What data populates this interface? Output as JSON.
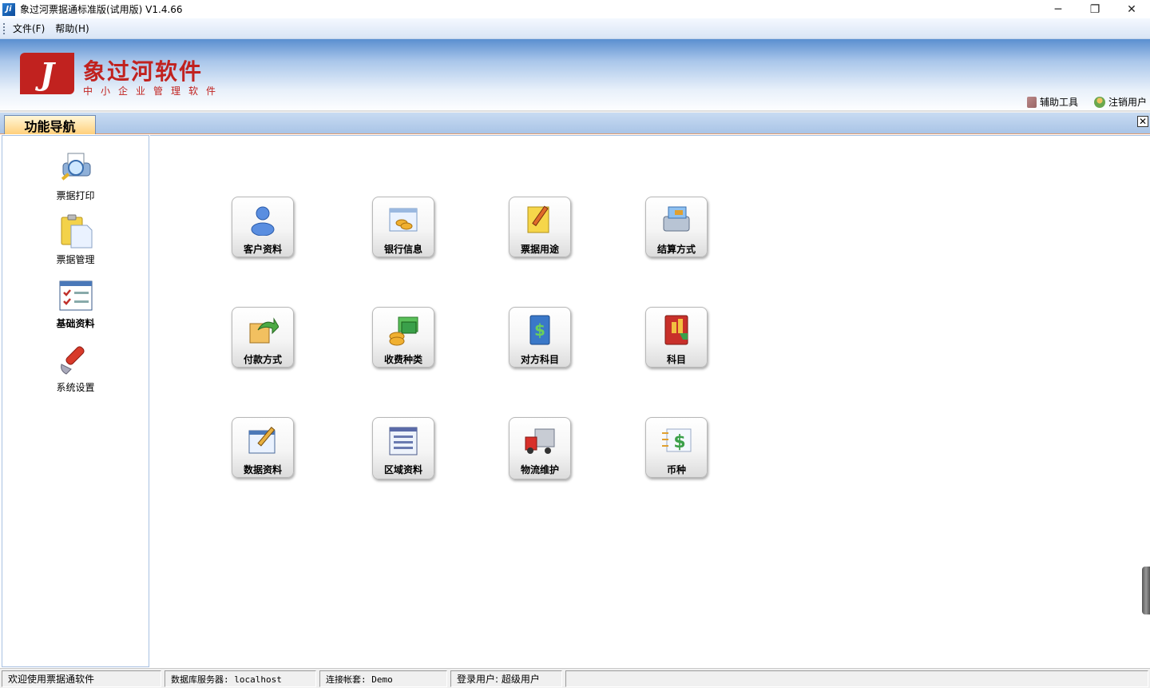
{
  "window": {
    "title": "象过河票据通标准版(试用版) V1.4.66",
    "app_icon_text": "Ji",
    "controls": {
      "minimize": "─",
      "restore": "❐",
      "close": "✕"
    }
  },
  "menu": {
    "items": [
      {
        "label": "文件(F)"
      },
      {
        "label": "帮助(H)"
      }
    ]
  },
  "banner": {
    "logo_mark": "J",
    "title": "象过河软件",
    "subtitle": "中小企业管理软件",
    "tools": [
      {
        "label": "辅助工具",
        "icon": "tools-icon"
      },
      {
        "label": "注销用户",
        "icon": "user-logout-icon"
      }
    ]
  },
  "tab": {
    "label": "功能导航",
    "close": "✕"
  },
  "sidebar": {
    "items": [
      {
        "label": "票据打印",
        "icon": "print-icon",
        "bold": false
      },
      {
        "label": "票据管理",
        "icon": "clipboard-icon",
        "bold": false
      },
      {
        "label": "基础资料",
        "icon": "checklist-icon",
        "bold": true
      },
      {
        "label": "系统设置",
        "icon": "wrench-icon",
        "bold": false
      }
    ]
  },
  "tiles": [
    {
      "label": "客户资料",
      "icon": "customer-icon"
    },
    {
      "label": "银行信息",
      "icon": "bank-icon"
    },
    {
      "label": "票据用途",
      "icon": "note-edit-icon"
    },
    {
      "label": "结算方式",
      "icon": "cash-register-icon"
    },
    {
      "label": "付款方式",
      "icon": "payment-icon"
    },
    {
      "label": "收费种类",
      "icon": "fee-type-icon"
    },
    {
      "label": "对方科目",
      "icon": "ledger-dollar-icon"
    },
    {
      "label": "科目",
      "icon": "account-book-icon"
    },
    {
      "label": "数据资料",
      "icon": "data-edit-icon"
    },
    {
      "label": "区域资料",
      "icon": "list-window-icon"
    },
    {
      "label": "物流维护",
      "icon": "truck-icon"
    },
    {
      "label": "币种",
      "icon": "currency-icon"
    }
  ],
  "status": {
    "welcome": "欢迎使用票据通软件",
    "db_server": "数据库服务器: localhost",
    "account_set": "连接帐套: Demo",
    "login_user": "登录用户: 超级用户"
  }
}
